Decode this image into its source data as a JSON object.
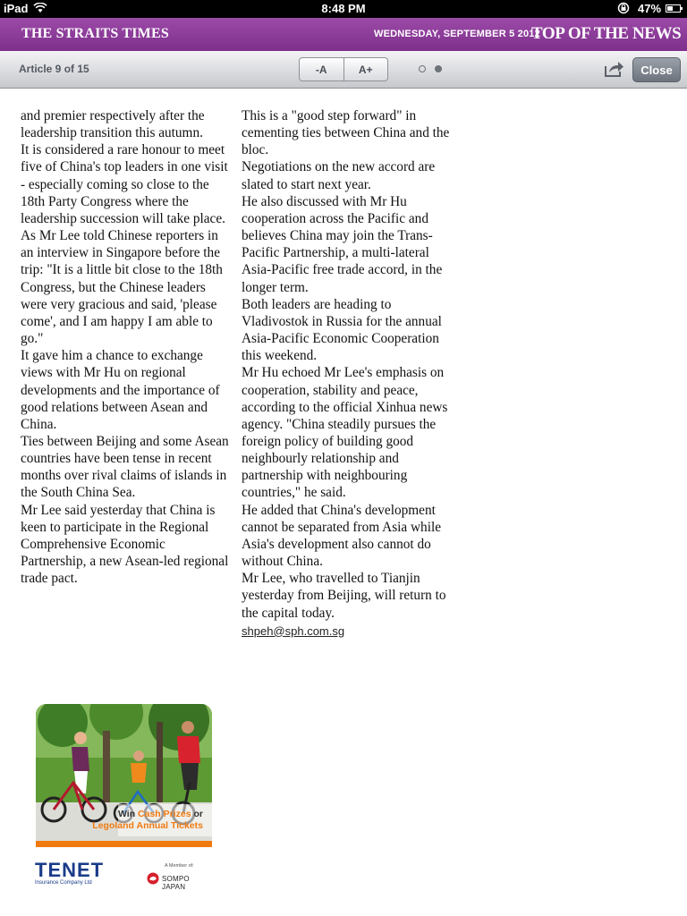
{
  "status_bar": {
    "device": "iPad",
    "time": "8:48 PM",
    "battery": "47%",
    "battery_level": 0.47
  },
  "masthead": {
    "brand": "THE STRAITS TIMES",
    "date": "WEDNESDAY, SEPTEMBER 5 2012",
    "section": "TOP OF THE NEWS"
  },
  "toolbar": {
    "article_counter": "Article 9 of 15",
    "font_decrease": "-A",
    "font_increase": "A+",
    "close": "Close"
  },
  "article": {
    "col1": [
      "and premier respectively after the leadership transition this autumn.",
      " It is considered a rare honour to meet five of China's top leaders in one visit - especially coming so close to the 18th Party Congress where the leadership succession will take place.",
      " As Mr Lee told Chinese reporters in an interview in Singapore before the trip: \"It is a little bit close to the 18th Congress, but the Chinese leaders were very gracious and said, 'please come', and I am happy I am able to go.\"",
      " It gave him a chance to exchange views with Mr Hu on regional developments and the importance of good relations between Asean and China.",
      " Ties between Beijing and some Asean countries have been tense in recent months over rival claims of islands in the South China Sea.",
      " Mr Lee said yesterday that China is keen to participate in the Regional Comprehensive Economic Partnership, a new Asean-led regional trade pact."
    ],
    "col2": [
      "This is a \"good step forward\" in cementing ties between China and the bloc.",
      " Negotiations on the new accord are slated to start next year.",
      " He also discussed with Mr Hu cooperation across the Pacific and believes China may join the Trans-Pacific Partnership, a multi-lateral Asia-Pacific free trade accord, in the longer term.",
      " Both leaders are heading to Vladivostok in Russia for the annual Asia-Pacific Economic Cooperation this weekend.",
      " Mr Hu echoed Mr Lee's emphasis on cooperation, stability and peace, according to the official Xinhua news agency. \"China steadily pursues the foreign policy of building good neighbourly relationship and partnership with neighbouring countries,\" he said.",
      " He added that China's development cannot be separated from Asia while Asia's development also cannot do without China.",
      " Mr Lee, who travelled to Tianjin yesterday from Beijing, will return to the capital today."
    ],
    "email": "shpeh@sph.com.sg"
  },
  "advert": {
    "line1_prefix": "Win ",
    "line1_highlight": "Cash Prizes",
    "line1_suffix": " or",
    "line2": "Legoland Annual Tickets",
    "sponsor_name": "TENET",
    "sponsor_sub": "Insurance Company Ltd",
    "member_of": "A Member of:",
    "parent": "SOMPO JAPAN",
    "accent_color": "#f07a10"
  },
  "colors": {
    "masthead": "#8a3a98",
    "text": "#111111"
  }
}
